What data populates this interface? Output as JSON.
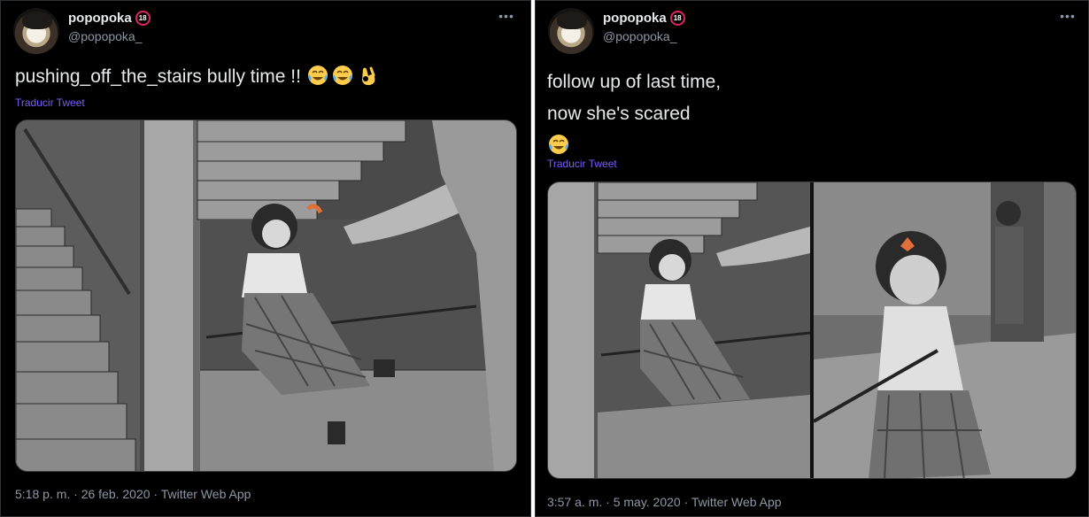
{
  "tweets": [
    {
      "display_name": "popopoka",
      "age_badge": "18",
      "handle": "@popopoka_",
      "more_icon": "ellipsis-icon",
      "text": "pushing_off_the_stairs bully time !!",
      "emojis": [
        "face-with-tears-of-joy-emoji",
        "face-with-tears-of-joy-emoji",
        "ok-hand-emoji"
      ],
      "translate_label": "Traducir Tweet",
      "media_alt_subject": "illustration",
      "timestamp": "5:18 p. m. · 26 feb. 2020 · Twitter Web App"
    },
    {
      "display_name": "popopoka",
      "age_badge": "18",
      "handle": "@popopoka_",
      "more_icon": "ellipsis-icon",
      "text_line_1": "follow up of last time,",
      "text_line_2": "now she's scared",
      "emojis": [
        "face-with-tears-of-joy-emoji"
      ],
      "translate_label": "Traducir Tweet",
      "timestamp": "3:57 a. m. · 5 may. 2020 · Twitter Web App"
    }
  ],
  "colors": {
    "background": "#000000",
    "text": "#e7e9ea",
    "muted": "#8b98a5",
    "link": "#7b5cff",
    "badge": "#e0245e"
  }
}
